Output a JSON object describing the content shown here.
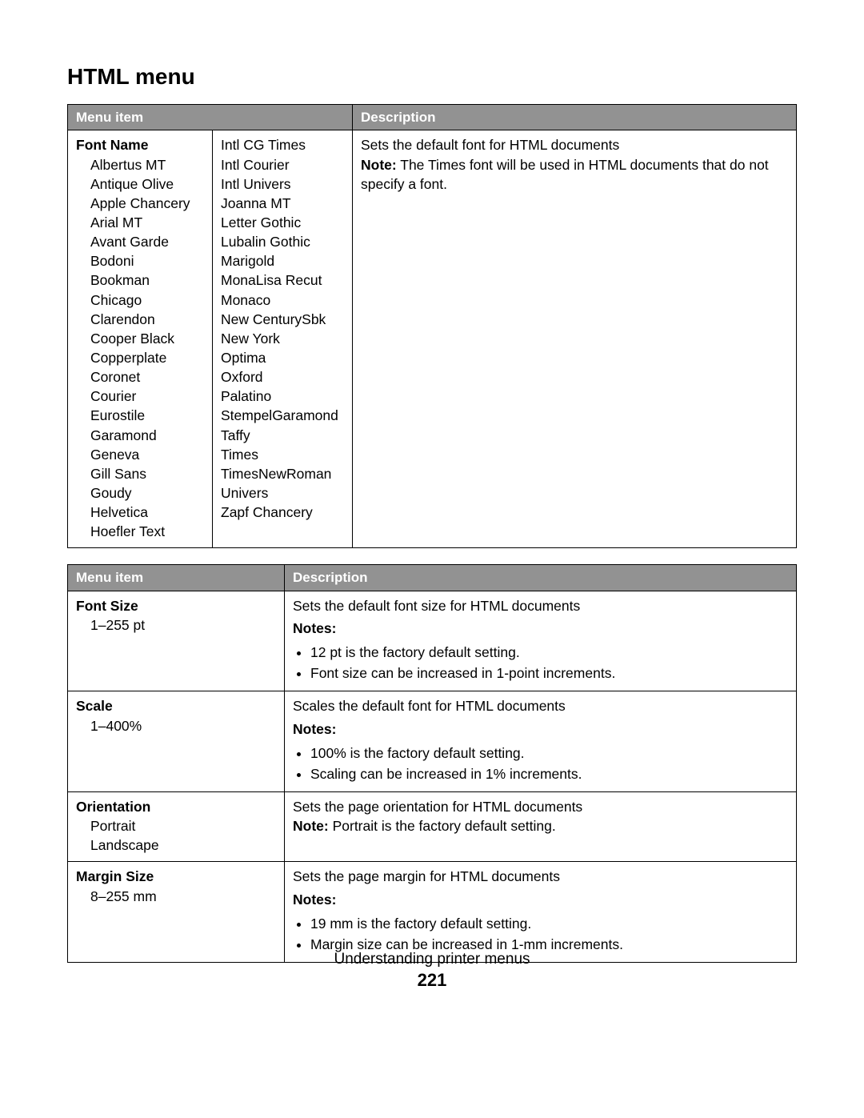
{
  "title": "HTML menu",
  "table1_header": {
    "col1": "Menu item",
    "col2": "Description"
  },
  "font_name": {
    "label": "Font Name",
    "fonts_col1": [
      "Albertus MT",
      "Antique Olive",
      "Apple Chancery",
      "Arial MT",
      "Avant Garde",
      "Bodoni",
      "Bookman",
      "Chicago",
      "Clarendon",
      "Cooper Black",
      "Copperplate",
      "Coronet",
      "Courier",
      "Eurostile",
      "Garamond",
      "Geneva",
      "Gill Sans",
      "Goudy",
      "Helvetica",
      "Hoefler Text"
    ],
    "fonts_col2": [
      "Intl CG Times",
      "Intl Courier",
      "Intl Univers",
      "Joanna MT",
      "Letter Gothic",
      "Lubalin Gothic",
      "Marigold",
      "MonaLisa Recut",
      "Monaco",
      "New CenturySbk",
      "New York",
      "Optima",
      "Oxford",
      "Palatino",
      "StempelGaramond",
      "Taffy",
      "Times",
      "TimesNewRoman",
      "Univers",
      "Zapf Chancery"
    ],
    "desc_main": "Sets the default font for HTML documents",
    "desc_note_label": "Note:",
    "desc_note_text": " The Times font will be used in HTML documents that do not specify a font."
  },
  "table2_header": {
    "col1": "Menu item",
    "col2": "Description"
  },
  "rows": [
    {
      "name": "Font Size",
      "subs": [
        "1–255 pt"
      ],
      "desc": "Sets the default font size for HTML documents",
      "notes_label": "Notes:",
      "notes": [
        "12 pt is the factory default setting.",
        "Font size can be increased in 1-point increments."
      ]
    },
    {
      "name": "Scale",
      "subs": [
        "1–400%"
      ],
      "desc": "Scales the default font for HTML documents",
      "notes_label": "Notes:",
      "notes": [
        "100% is the factory default setting.",
        "Scaling can be increased in 1% increments."
      ]
    },
    {
      "name": "Orientation",
      "subs": [
        "Portrait",
        "Landscape"
      ],
      "desc": "Sets the page orientation for HTML documents",
      "inline_note_label": "Note:",
      "inline_note_text": " Portrait is the factory default setting."
    },
    {
      "name": "Margin Size",
      "subs": [
        "8–255 mm"
      ],
      "desc": "Sets the page margin for HTML documents",
      "notes_label": "Notes:",
      "notes": [
        "19 mm is the factory default setting.",
        "Margin size can be increased in 1-mm increments."
      ]
    }
  ],
  "footer": {
    "line1": "Understanding printer menus",
    "page": "221"
  }
}
